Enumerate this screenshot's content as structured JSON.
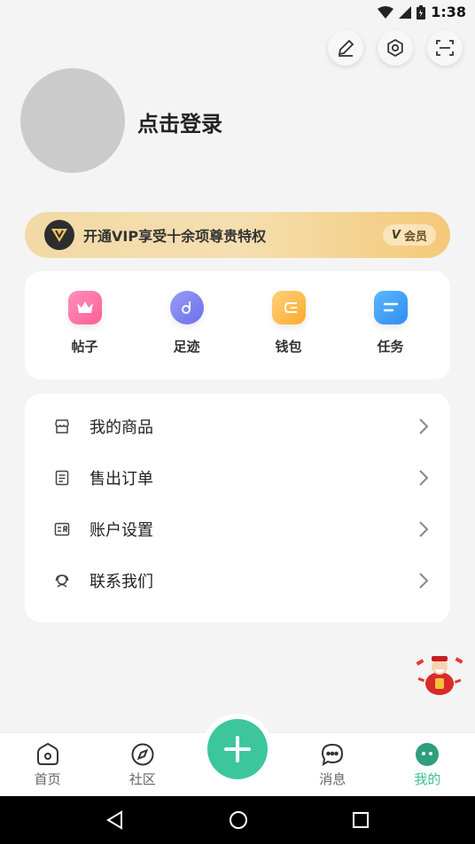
{
  "status_bar": {
    "time": "1:38",
    "icons": [
      "wifi-icon",
      "signal-icon",
      "battery-icon"
    ]
  },
  "top_actions": [
    {
      "name": "edit-icon"
    },
    {
      "name": "settings-icon"
    },
    {
      "name": "scan-icon"
    }
  ],
  "profile": {
    "login_text": "点击登录"
  },
  "vip": {
    "text": "开通VIP享受十余项尊贵特权",
    "badge_prefix": "V",
    "badge_text": "会员"
  },
  "quick": [
    {
      "label": "帖子",
      "icon": "crown-icon",
      "color": "#ff6fa5"
    },
    {
      "label": "足迹",
      "icon": "footprint-icon",
      "color": "#7b7ff0"
    },
    {
      "label": "钱包",
      "icon": "wallet-icon",
      "color": "#ffb83a"
    },
    {
      "label": "任务",
      "icon": "task-icon",
      "color": "#3a9df5"
    }
  ],
  "menu": [
    {
      "label": "我的商品",
      "icon": "store-icon"
    },
    {
      "label": "售出订单",
      "icon": "order-icon"
    },
    {
      "label": "账户设置",
      "icon": "account-card-icon"
    },
    {
      "label": "联系我们",
      "icon": "support-icon"
    }
  ],
  "nav": [
    {
      "label": "首页",
      "icon": "home-icon"
    },
    {
      "label": "社区",
      "icon": "compass-icon"
    },
    {
      "label": "消息",
      "icon": "chat-icon"
    },
    {
      "label": "我的",
      "icon": "profile-face-icon",
      "active": true
    }
  ],
  "colors": {
    "accent": "#3dc69b",
    "vip_gold": "#f4c978"
  }
}
